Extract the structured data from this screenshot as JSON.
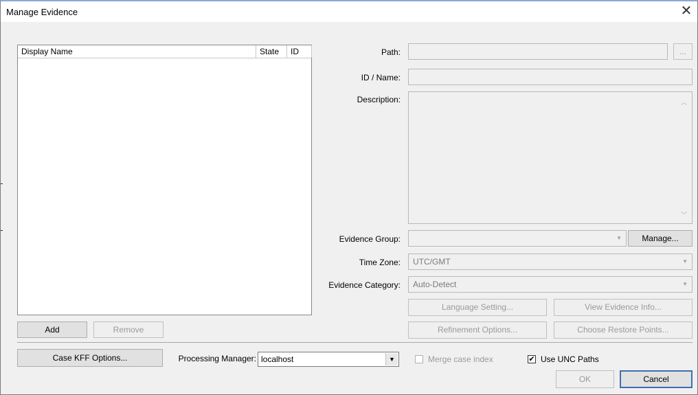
{
  "window": {
    "title": "Manage Evidence",
    "close_glyph": "✕"
  },
  "evidence_list": {
    "columns": [
      "Display Name",
      "State",
      "ID"
    ],
    "rows": []
  },
  "buttons": {
    "add": "Add",
    "remove": "Remove",
    "browse": "...",
    "manage": "Manage...",
    "language_setting": "Language Setting...",
    "view_evidence_info": "View Evidence Info...",
    "refinement_options": "Refinement Options...",
    "choose_restore_points": "Choose Restore Points...",
    "case_kff_options": "Case KFF Options...",
    "ok": "OK",
    "cancel": "Cancel"
  },
  "form": {
    "path_label": "Path:",
    "path_value": "",
    "id_name_label": "ID / Name:",
    "id_name_value": "",
    "description_label": "Description:",
    "description_value": "",
    "evidence_group_label": "Evidence Group:",
    "evidence_group_value": "",
    "time_zone_label": "Time Zone:",
    "time_zone_value": "UTC/GMT",
    "evidence_category_label": "Evidence Category:",
    "evidence_category_value": "Auto-Detect"
  },
  "processing": {
    "label": "Processing Manager:",
    "value": "localhost"
  },
  "options": {
    "merge_case_index_label": "Merge case index",
    "merge_case_index_checked": false,
    "use_unc_paths_label": "Use UNC Paths",
    "use_unc_paths_checked": true
  },
  "icons": {
    "dropdown": "chevron-down-icon",
    "scroll_up": "chevron-up-icon",
    "scroll_down": "chevron-down-icon",
    "check": "check-icon"
  }
}
